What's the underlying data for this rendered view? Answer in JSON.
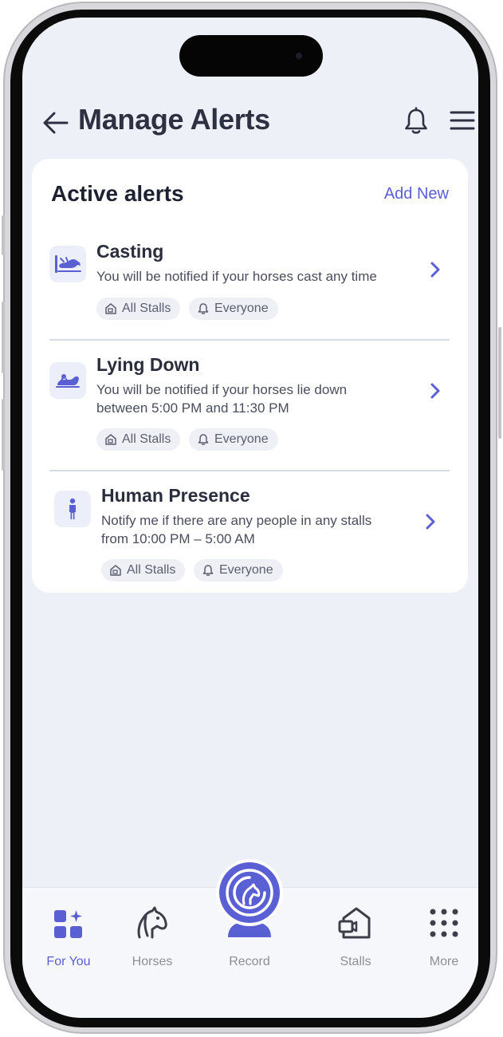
{
  "header": {
    "title": "Manage Alerts"
  },
  "card": {
    "title": "Active alerts",
    "add_new": "Add New",
    "alerts": [
      {
        "title": "Casting",
        "desc_line1": "You will be notified if your horses cast any time",
        "desc_line2": "",
        "stalls": "All Stalls",
        "audience": "Everyone",
        "icon": "horse-casting-icon"
      },
      {
        "title": "Lying Down",
        "desc_line1": "You will be notified if your horses lie down",
        "desc_line2": "between 5:00 PM and 11:30 PM",
        "stalls": "All Stalls",
        "audience": "Everyone",
        "icon": "horse-lying-icon"
      },
      {
        "title": "Human Presence",
        "desc_line1": "Notify me if there are any people in any stalls",
        "desc_line2": "from 10:00 PM – 5:00 AM",
        "stalls": "All Stalls",
        "audience": "Everyone",
        "icon": "person-icon"
      }
    ]
  },
  "tabbar": {
    "tabs": [
      {
        "label": "For You",
        "icon": "grid-sparkle-icon",
        "active": true
      },
      {
        "label": "Horses",
        "icon": "horse-head-icon",
        "active": false
      },
      {
        "label": "Record",
        "icon": "record-camera-icon",
        "active": false
      },
      {
        "label": "Stalls",
        "icon": "stall-camera-icon",
        "active": false
      },
      {
        "label": "More",
        "icon": "dots-grid-icon",
        "active": false
      }
    ]
  },
  "colors": {
    "accent": "#5b5fd4",
    "background": "#eef0f7",
    "title_text": "#2d3142"
  }
}
